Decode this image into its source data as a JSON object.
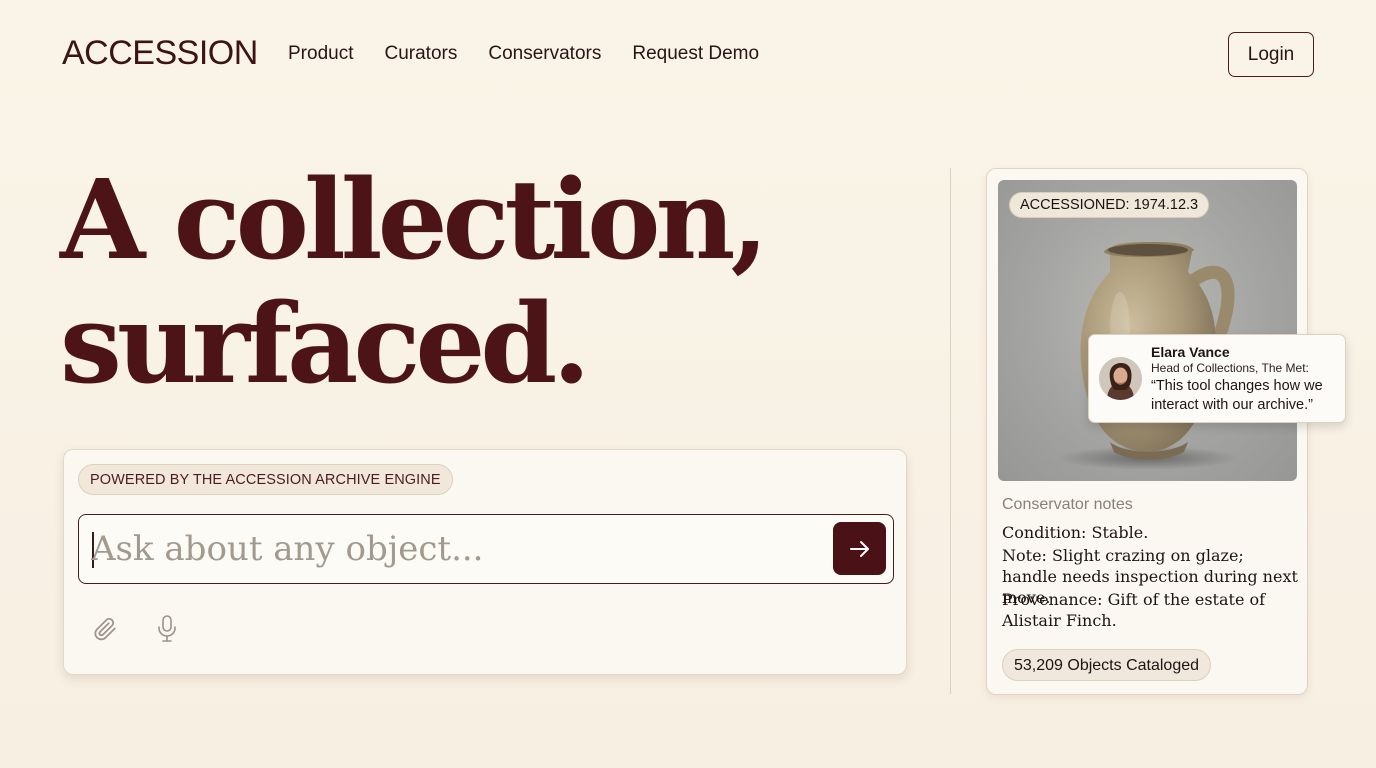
{
  "header": {
    "brand": "ACCESSION",
    "nav": [
      "Product",
      "Curators",
      "Conservators",
      "Request Demo"
    ],
    "login_label": "Login"
  },
  "hero": {
    "title_line1": "A collection,",
    "title_line2": "surfaced."
  },
  "search": {
    "badge": "POWERED BY THE ACCESSION ARCHIVE ENGINE",
    "placeholder": "Ask about any object...",
    "value": ""
  },
  "object": {
    "accession_badge": "ACCESSIONED: 1974.12.3",
    "notes_label": "Conservator notes",
    "notes": [
      "Condition: Stable.",
      "Note: Slight crazing on glaze; handle needs inspection during next move.",
      "Provenance: Gift of the estate of Alistair Finch."
    ],
    "count_badge": "53,209 Objects Cataloged"
  },
  "testimonial": {
    "name": "Elara Vance",
    "role": "Head of Collections, The Met:",
    "quote": "“This tool changes how we interact with our archive.”"
  },
  "colors": {
    "background": "#f8f1e4",
    "accent": "#4a1216",
    "hero_text": "#4d1417"
  },
  "icons": [
    "arrow-right-icon",
    "paperclip-icon",
    "microphone-icon"
  ]
}
